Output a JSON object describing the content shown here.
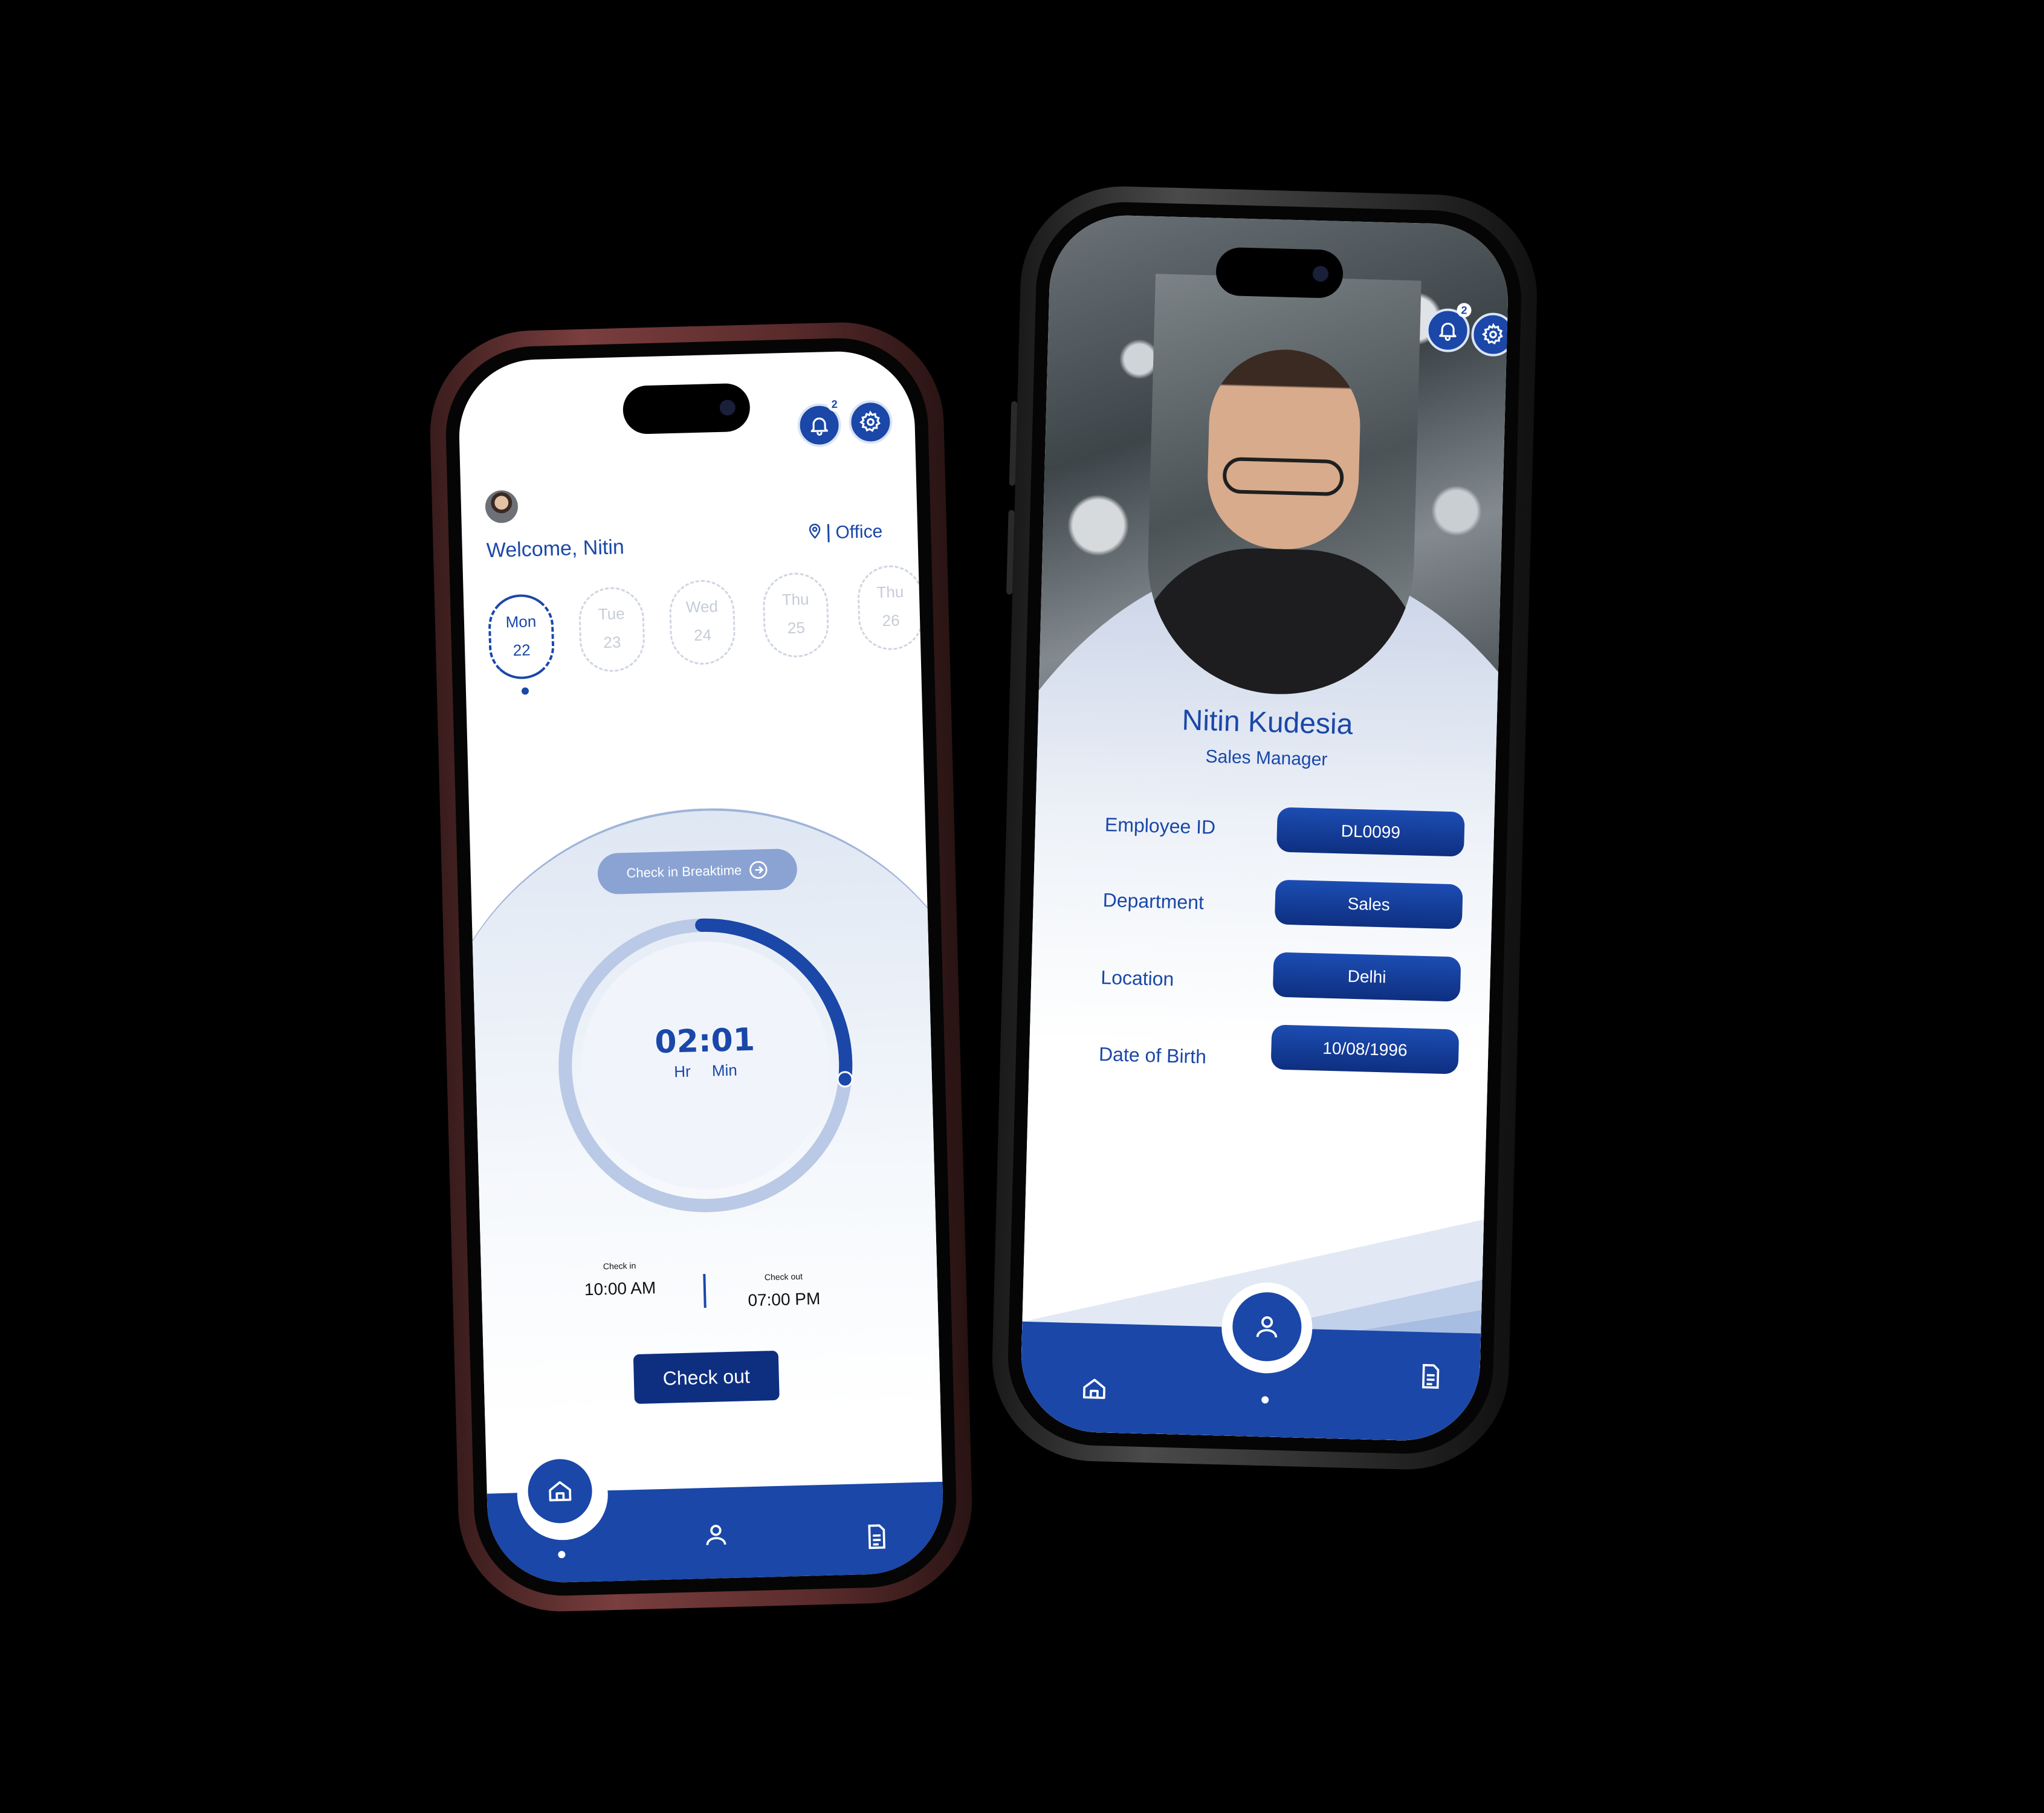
{
  "left_screen": {
    "notification_count": "2",
    "welcome_text": "Welcome, Nitin",
    "location_label": "Office",
    "days": [
      {
        "name": "Mon",
        "date": "22",
        "active": true
      },
      {
        "name": "Tue",
        "date": "23",
        "active": false
      },
      {
        "name": "Wed",
        "date": "24",
        "active": false
      },
      {
        "name": "Thu",
        "date": "25",
        "active": false
      },
      {
        "name": "Thu",
        "date": "26",
        "active": false
      }
    ],
    "breaktime_button": "Check in Breaktime",
    "timer": {
      "time": "02:01",
      "hr_label": "Hr",
      "min_label": "Min",
      "progress": 0.27
    },
    "check_in": {
      "label": "Check in",
      "time": "10:00 AM"
    },
    "check_out": {
      "label": "Check out",
      "time": "07:00 PM"
    },
    "checkout_button": "Check out"
  },
  "right_screen": {
    "notification_count": "2",
    "name": "Nitin Kudesia",
    "role": "Sales Manager",
    "fields": [
      {
        "label": "Employee ID",
        "value": "DL0099"
      },
      {
        "label": "Department",
        "value": "Sales"
      },
      {
        "label": "Location",
        "value": "Delhi"
      },
      {
        "label": "Date of Birth",
        "value": "10/08/1996"
      }
    ]
  },
  "icons": {
    "notification": "bell-icon",
    "settings": "gear-icon",
    "location": "pin-icon",
    "arrow": "arrow-right-circle-icon",
    "home": "home-icon",
    "profile": "user-icon",
    "documents": "document-icon"
  },
  "colors": {
    "primary": "#1a47a8",
    "primary_dark": "#0e2f80",
    "accent_light": "#8aa3d3"
  }
}
